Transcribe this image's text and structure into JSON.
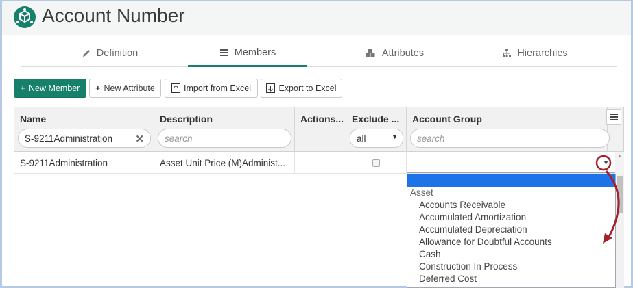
{
  "header": {
    "title": "Account Number"
  },
  "tabs": [
    {
      "label": "Definition",
      "icon": "pencil-icon"
    },
    {
      "label": "Members",
      "icon": "list-icon"
    },
    {
      "label": "Attributes",
      "icon": "cubes-icon"
    },
    {
      "label": "Hierarchies",
      "icon": "sitemap-icon"
    }
  ],
  "toolbar": {
    "new_member": "New Member",
    "new_attribute": "New Attribute",
    "import": "Import from Excel",
    "export": "Export to Excel"
  },
  "grid": {
    "columns": [
      "Name",
      "Description",
      "Actions...",
      "Exclude ...",
      "Account Group"
    ],
    "filters": {
      "name_value": "S-9211Administration",
      "description_placeholder": "search",
      "exclude_value": "all",
      "account_group_placeholder": "search"
    },
    "rows": [
      {
        "name": "S-9211Administration",
        "description": "Asset Unit Price (M)Administ..."
      }
    ]
  },
  "dropdown": {
    "group": "Asset",
    "options": [
      "Accounts Receivable",
      "Accumulated Amortization",
      "Accumulated Depreciation",
      "Allowance for Doubtful Accounts",
      "Cash",
      "Construction In Process",
      "Deferred Cost"
    ]
  },
  "colors": {
    "accent": "#16806b",
    "selection": "#1e73e8",
    "annotation": "#a3212d"
  }
}
